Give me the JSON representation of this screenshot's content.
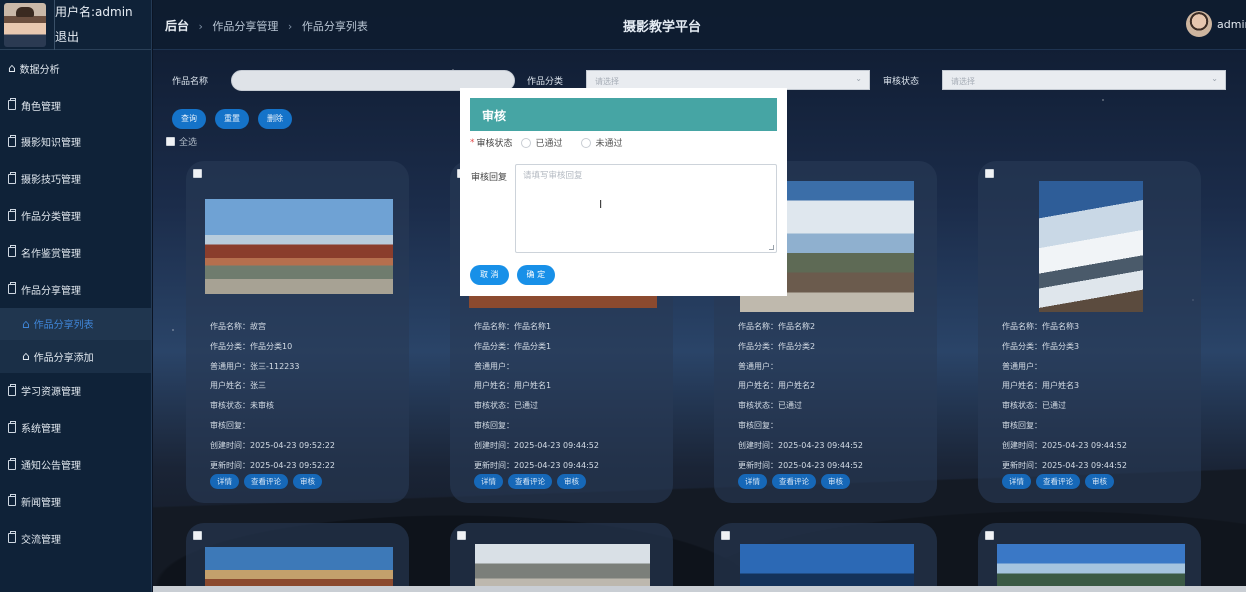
{
  "sidebar": {
    "username": "用户名:admin",
    "logout": "退出",
    "items": [
      {
        "label": "数据分析",
        "icon": "home-icon"
      },
      {
        "label": "角色管理",
        "icon": "document-icon"
      },
      {
        "label": "摄影知识管理",
        "icon": "document-icon"
      },
      {
        "label": "摄影技巧管理",
        "icon": "document-icon"
      },
      {
        "label": "作品分类管理",
        "icon": "document-icon"
      },
      {
        "label": "名作鉴赏管理",
        "icon": "document-icon"
      },
      {
        "label": "作品分享管理",
        "icon": "document-icon"
      }
    ],
    "subitems": [
      {
        "label": "作品分享列表",
        "icon": "home-icon",
        "active": true
      },
      {
        "label": "作品分享添加",
        "icon": "home-icon"
      }
    ],
    "items2": [
      {
        "label": "学习资源管理"
      },
      {
        "label": "系统管理"
      },
      {
        "label": "通知公告管理"
      },
      {
        "label": "新闻管理"
      },
      {
        "label": "交流管理"
      }
    ]
  },
  "header": {
    "breadcrumb_root": "后台",
    "breadcrumb_1": "作品分享管理",
    "breadcrumb_2": "作品分享列表",
    "platform_title": "摄影教学平台",
    "user": "admin"
  },
  "filters": {
    "name_label": "作品名称",
    "category_label": "作品分类",
    "category_placeholder": "请选择",
    "status_label": "审核状态",
    "status_placeholder": "请选择"
  },
  "actions": {
    "search": "查询",
    "reset": "重置",
    "delete": "删除",
    "select_all": "全选"
  },
  "cards": [
    {
      "name": "作品名称：故宫",
      "category": "作品分类：作品分类10",
      "user": "普通用户：张三-112233",
      "realname": "用户姓名：张三",
      "status": "审核状态：未审核",
      "reply": "审核回复：",
      "created": "创建时间：2025-04-23 09:52:22",
      "updated": "更新时间：2025-04-23 09:52:22"
    },
    {
      "name": "作品名称：作品名称1",
      "category": "作品分类：作品分类1",
      "user": "普通用户：",
      "realname": "用户姓名：用户姓名1",
      "status": "审核状态：已通过",
      "reply": "审核回复：",
      "created": "创建时间：2025-04-23 09:44:52",
      "updated": "更新时间：2025-04-23 09:44:52"
    },
    {
      "name": "作品名称：作品名称2",
      "category": "作品分类：作品分类2",
      "user": "普通用户：",
      "realname": "用户姓名：用户姓名2",
      "status": "审核状态：已通过",
      "reply": "审核回复：",
      "created": "创建时间：2025-04-23 09:44:52",
      "updated": "更新时间：2025-04-23 09:44:52"
    },
    {
      "name": "作品名称：作品名称3",
      "category": "作品分类：作品分类3",
      "user": "普通用户：",
      "realname": "用户姓名：用户姓名3",
      "status": "审核状态：已通过",
      "reply": "审核回复：",
      "created": "创建时间：2025-04-23 09:44:52",
      "updated": "更新时间：2025-04-23 09:44:52"
    }
  ],
  "card_actions": {
    "detail": "详情",
    "comments": "查看评论",
    "review": "审核"
  },
  "modal": {
    "title": "审核",
    "status_label": "审核状态",
    "option_pass": "已通过",
    "option_fail": "未通过",
    "reply_label": "审核回复",
    "reply_placeholder": "请填写审核回复",
    "cancel": "取 消",
    "confirm": "确 定"
  }
}
